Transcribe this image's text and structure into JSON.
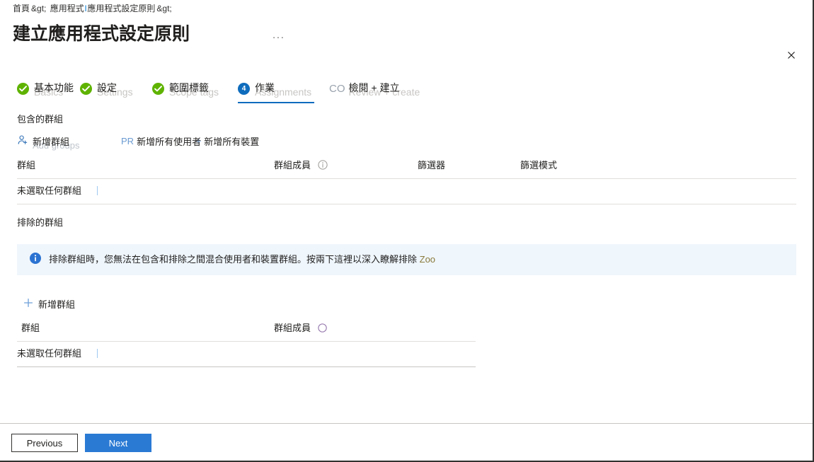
{
  "breadcrumb": {
    "items": [
      {
        "label": "首頁",
        "type": "link"
      },
      {
        "label": "&gt;",
        "type": "sep"
      },
      {
        "label": "應用程式",
        "type": "link"
      },
      {
        "label": "l",
        "type": "pipe"
      },
      {
        "label": "應用程式設定原則",
        "type": "link"
      },
      {
        "label": "&gt;",
        "type": "sep"
      }
    ]
  },
  "header": {
    "title": "建立應用程式設定原則",
    "more_label": "...",
    "close_label": "✕",
    "more_icon": "ellipsis-horizontal-icon",
    "close_icon": "close-icon"
  },
  "steps": [
    {
      "label": "基本功能",
      "ghost": "Basics",
      "state": "done",
      "badge": "check-circle-icon"
    },
    {
      "label": "設定",
      "ghost": "Settings",
      "state": "done",
      "badge": "check-circle-icon"
    },
    {
      "label": "範圍標籤",
      "ghost": "Scope tags",
      "state": "done",
      "badge": "check-circle-icon"
    },
    {
      "label": "作業",
      "ghost": "Assignments",
      "state": "current",
      "badge": "4"
    },
    {
      "label": "檢閱 + 建立",
      "ghost": "Review + create",
      "state": "pending",
      "badge": "co"
    }
  ],
  "included": {
    "section_label": "包含的群組",
    "commands": [
      {
        "label": "新增群組",
        "ghost": "Add groups",
        "icon": "add-person-icon"
      },
      {
        "label": "新增所有使用者",
        "ghost": "",
        "icon": "pr-prefix"
      },
      {
        "label": "新增所有裝置",
        "ghost": "",
        "icon": "plus-prefix"
      }
    ],
    "table": {
      "headers": [
        "群組",
        "群組成員",
        "篩選器",
        "篩選模式"
      ],
      "header_info_icon": "info-circle-icon",
      "rows": [
        {
          "group": "未選取任何群組",
          "members": "",
          "filter": "",
          "filter_mode": ""
        }
      ]
    }
  },
  "excluded": {
    "section_label": "排除的群組",
    "banner": {
      "icon": "info-filled-icon",
      "text": "排除群組時，您無法在包含和排除之間混合使用者和裝置群組。按兩下這裡以深入瞭解排除 ",
      "link_text": "Zoo"
    },
    "commands": [
      {
        "label": "新增群組",
        "ghost": "",
        "icon": "plus-icon"
      }
    ],
    "table": {
      "headers": [
        "群組",
        "群組成員"
      ],
      "header_info_icon": "info-circle-icon",
      "rows": [
        {
          "group": "未選取任何群組",
          "members": ""
        }
      ]
    }
  },
  "footer": {
    "previous_label": "Previous",
    "next_label": "Next"
  },
  "colors": {
    "accent": "#0f6cbd",
    "primary_button": "#2a7ad4",
    "success": "#5fb300",
    "banner_bg": "#eff6fc",
    "ghost_text": "#c8c6c4"
  }
}
